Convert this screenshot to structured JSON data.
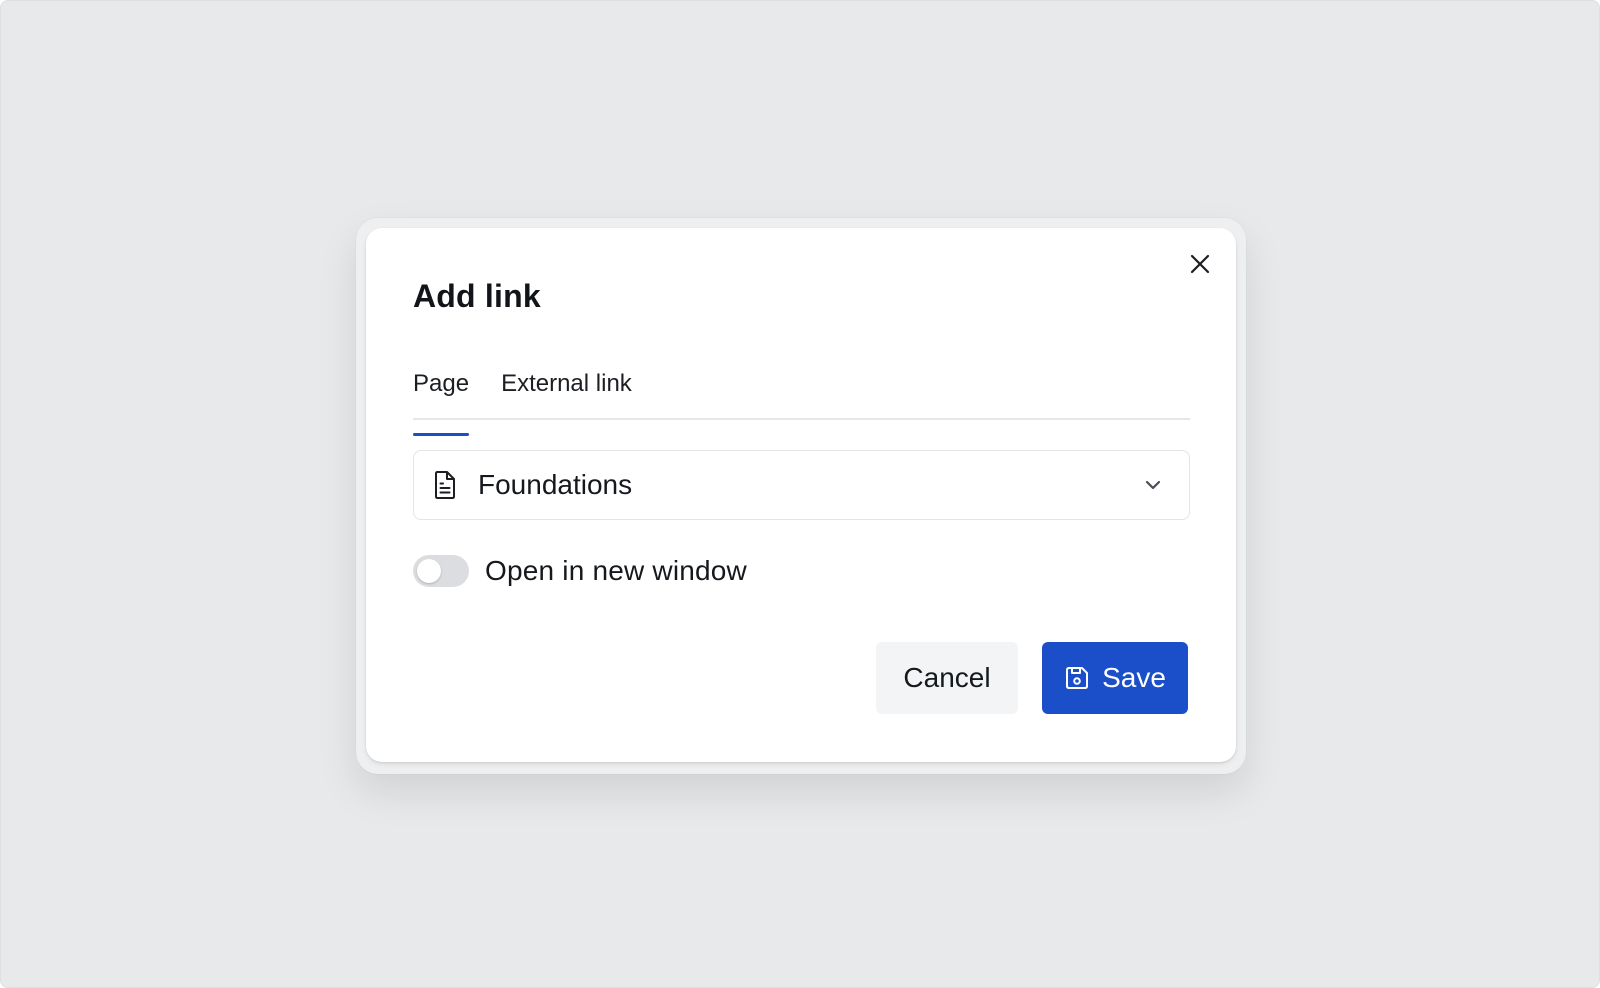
{
  "dialog": {
    "title": "Add link",
    "tabs": [
      {
        "label": "Page",
        "active": true
      },
      {
        "label": "External link",
        "active": false
      }
    ],
    "page_select": {
      "value": "Foundations",
      "icon": "document-icon"
    },
    "toggle": {
      "label": "Open in new window",
      "on": false
    },
    "buttons": {
      "cancel_label": "Cancel",
      "save_label": "Save"
    }
  },
  "colors": {
    "accent": "#1a4fc9",
    "backdrop": "#e8e9eb",
    "toggle_off": "#dcdde0",
    "cancel_bg": "#f3f4f5"
  }
}
